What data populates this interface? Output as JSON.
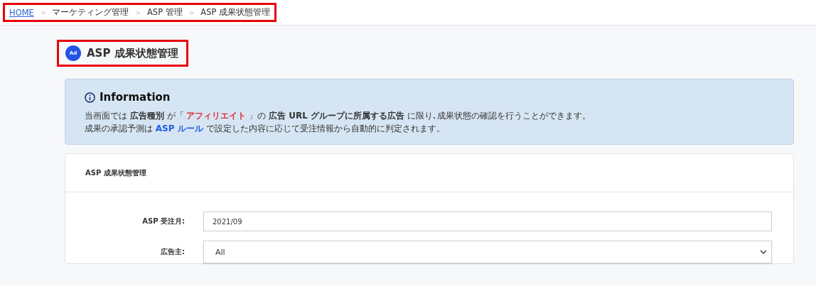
{
  "breadcrumb_separator": ">",
  "breadcrumbs": [
    {
      "label": "HOME",
      "kind": "link"
    },
    {
      "label": "マーケティング管理",
      "kind": "text"
    },
    {
      "label": "ASP 管理",
      "kind": "text"
    },
    {
      "label": "ASP 成果状態管理",
      "kind": "text"
    }
  ],
  "page": {
    "badge": "Ad",
    "title": "ASP 成果状態管理"
  },
  "information": {
    "title": "Information",
    "lines": [
      [
        {
          "kind": "plain",
          "text": "当画面では "
        },
        {
          "kind": "bold",
          "text": "広告種別"
        },
        {
          "kind": "plain",
          "text": " が「 "
        },
        {
          "kind": "accent",
          "text": "アフィリエイト"
        },
        {
          "kind": "plain",
          "text": " 」の "
        },
        {
          "kind": "bold",
          "text": "広告 URL グループに所属する広告"
        },
        {
          "kind": "plain",
          "text": " に限り､成果状態の確認を行うことができます。"
        }
      ],
      [
        {
          "kind": "plain",
          "text": "成果の承認予測は "
        },
        {
          "kind": "link",
          "text": "ASP ルール"
        },
        {
          "kind": "plain",
          "text": " で設定した内容に応じて受注情報から自動的に判定されます。"
        }
      ]
    ]
  },
  "card": {
    "title": "ASP 成果状態管理",
    "fields": [
      {
        "kind": "text",
        "label": "ASP 受注月:",
        "value": "2021/09"
      },
      {
        "kind": "select",
        "label": "広告主:",
        "value": "All"
      }
    ]
  }
}
